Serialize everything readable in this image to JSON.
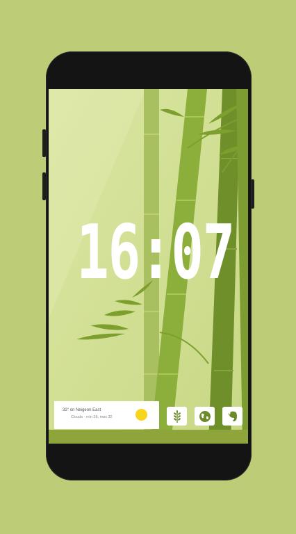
{
  "lockscreen": {
    "clock": "16:07"
  },
  "weather": {
    "title": "32° on Neigeon East",
    "subtitle": "Clouds · min 28, max 32",
    "icon": "sun-icon",
    "sun_color": "#f7d51a"
  },
  "dock": {
    "apps": [
      {
        "icon": "wheat-icon"
      },
      {
        "icon": "globe-icon"
      },
      {
        "icon": "evernote-icon"
      }
    ],
    "icon_color": "#6e8b2c"
  },
  "colors": {
    "background": "#bdcd77",
    "wallpaper_light": "#d0de8e",
    "bamboo": "#7c9f2e"
  }
}
